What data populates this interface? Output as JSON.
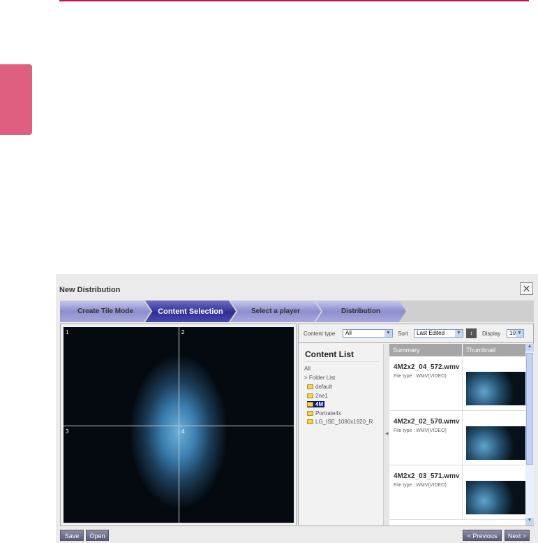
{
  "dialog": {
    "title": "New Distribution",
    "close_icon": "close-icon"
  },
  "steps": [
    "Create Tile Mode",
    "Content Selection",
    "Select a player",
    "Distribution"
  ],
  "preview": {
    "quadrants": [
      "1",
      "2",
      "3",
      "4"
    ]
  },
  "toolbar": {
    "content_type_label": "Content type",
    "content_type_value": "All",
    "sort_label": "Sort",
    "sort_value": "Last Edited",
    "display_label": "Display",
    "display_value": "10"
  },
  "content_list": {
    "title": "Content List",
    "all": "All",
    "folder_list": "> Folder List",
    "folders": [
      "default",
      "2ne1",
      "4M",
      "Portrate4x",
      "LG_ISE_1080x1920_R"
    ],
    "selected": "4M"
  },
  "table": {
    "headers": [
      "Summary",
      "Thumbnail"
    ],
    "rows": [
      {
        "name": "4M2x2_04_572.wmv",
        "type": "File type : WMV(VIDEO)"
      },
      {
        "name": "4M2x2_02_570.wmv",
        "type": "File type : WMV(VIDEO)"
      },
      {
        "name": "4M2x2_03_571.wmv",
        "type": "File type : WMV(VIDEO)"
      }
    ]
  },
  "buttons": {
    "save": "Save",
    "open": "Open",
    "previous": "< Previous",
    "next": "Next >"
  },
  "colors": {
    "accent": "#c8104e",
    "tab": "#de5f80",
    "active_step": "#2e2e96"
  }
}
